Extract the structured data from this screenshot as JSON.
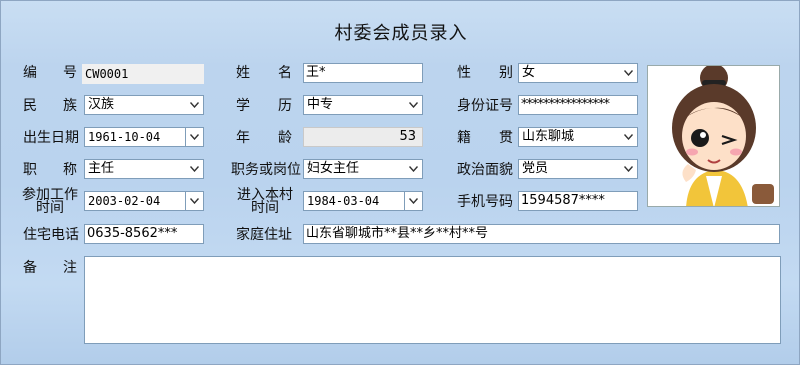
{
  "title": "村委会成员录入",
  "labels": {
    "id": [
      "编",
      "号"
    ],
    "name": [
      "姓",
      "名"
    ],
    "gender": [
      "性",
      "别"
    ],
    "ethnicity": [
      "民",
      "族"
    ],
    "education": [
      "学",
      "历"
    ],
    "idcard": "身份证号",
    "birth": "出生日期",
    "age": [
      "年",
      "龄"
    ],
    "origin": [
      "籍",
      "贯"
    ],
    "title": [
      "职",
      "称"
    ],
    "duty": "职务或岗位",
    "politics": "政治面貌",
    "work_time": [
      "参加工作",
      "时间"
    ],
    "village_time": [
      "进入本村",
      "时间"
    ],
    "phone": "手机号码",
    "home_phone": "住宅电话",
    "address": "家庭住址",
    "remark": [
      "备",
      "注"
    ]
  },
  "fields": {
    "id": "CW0001",
    "name": "王*",
    "gender": "女",
    "ethnicity": "汉族",
    "education": "中专",
    "idcard": "****************",
    "birth": "1961-10-04",
    "age": "53",
    "origin": "山东聊城",
    "title": "主任",
    "duty": "妇女主任",
    "politics": "党员",
    "work_time": "2003-02-04",
    "village_time": "1984-03-04",
    "phone": "1594587****",
    "home_phone": "0635-8562***",
    "address": "山东省聊城市**县**乡**村**号",
    "remark": ""
  },
  "date_separator": ":",
  "photo": {
    "icon": "cartoon-girl-avatar",
    "hair": "#5a3a2a",
    "jacket": "#f2c53a",
    "skin": "#fde0c8"
  }
}
